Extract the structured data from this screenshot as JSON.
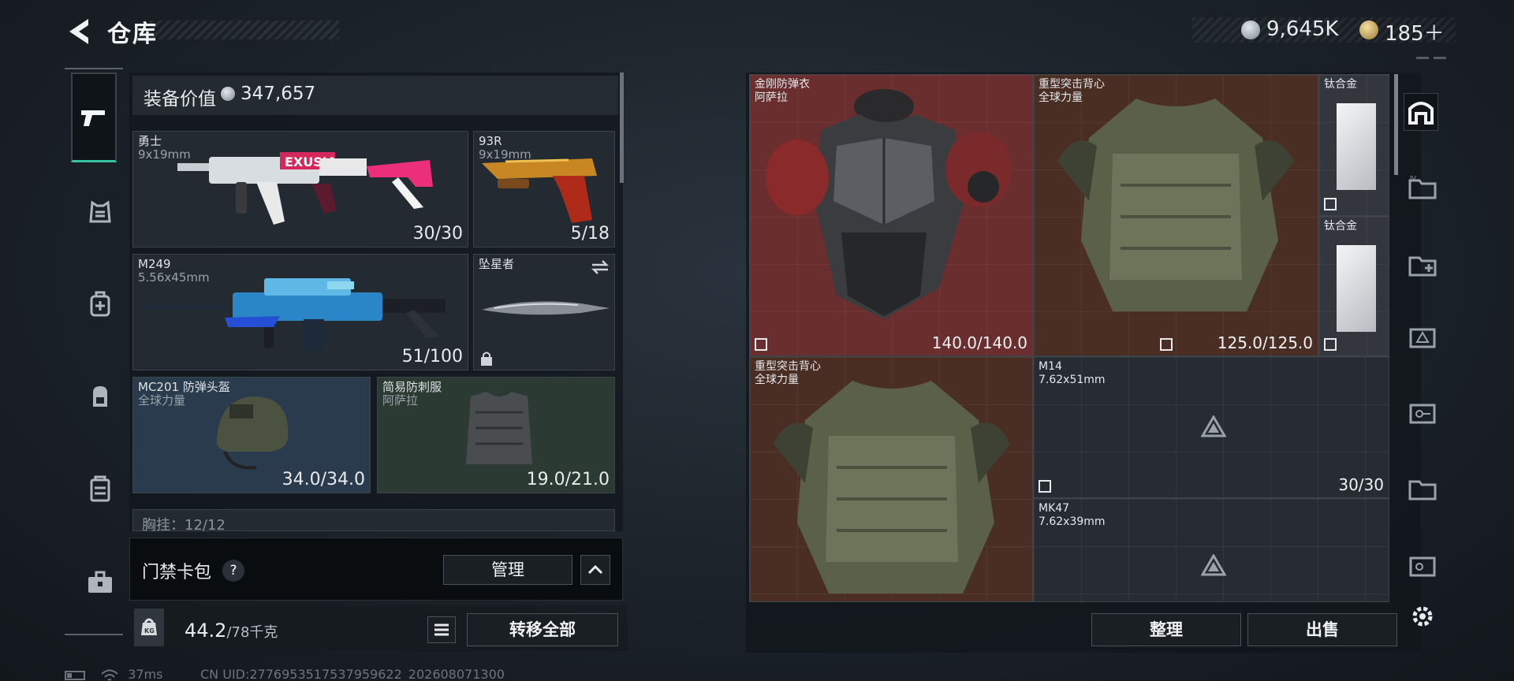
{
  "header": {
    "title": "仓库",
    "currency_silver": "9,645K",
    "currency_gold": "185＋"
  },
  "equipment": {
    "label": "装备价值",
    "value": "347,657"
  },
  "loadout": [
    {
      "name": "勇士",
      "ammo": "9x19mm",
      "count": "30/30"
    },
    {
      "name": "93R",
      "ammo": "9x19mm",
      "count": "5/18"
    },
    {
      "name": "M249",
      "ammo": "5.56x45mm",
      "count": "51/100"
    },
    {
      "name": "坠星者",
      "ammo": "",
      "count": ""
    },
    {
      "name": "MC201 防弹头盔",
      "brand": "全球力量",
      "count": "34.0/34.0"
    },
    {
      "name": "简易防刺服",
      "brand": "阿萨拉",
      "count": "19.0/21.0"
    }
  ],
  "chest_rig": {
    "text": "胸挂：12/12"
  },
  "card_pack": {
    "label": "门禁卡包",
    "help": "?",
    "manage": "管理"
  },
  "weight": {
    "current": "44.2",
    "capacity": "/78千克",
    "transfer_all": "转移全部"
  },
  "status": {
    "ping": "37ms",
    "uid": "CN UID:2776953517537959622_202608071300"
  },
  "storage": [
    {
      "name": "金刚防弹衣",
      "brand": "阿萨拉",
      "count": "140.0/140.0"
    },
    {
      "name": "重型突击背心",
      "brand": "全球力量",
      "count": "125.0/125.0"
    },
    {
      "name": "钛合金",
      "brand": "",
      "count": ""
    },
    {
      "name": "钛合金",
      "brand": "",
      "count": ""
    },
    {
      "name": "重型突击背心",
      "brand": "全球力量",
      "count": ""
    },
    {
      "name": "M14",
      "brand": "7.62x51mm",
      "count": "30/30"
    },
    {
      "name": "MK47",
      "brand": "7.62x39mm",
      "count": ""
    }
  ],
  "actions": {
    "tidy": "整理",
    "sell": "出售"
  },
  "colors": {
    "accent": "#39c1a4",
    "armor_red": "#6b2e2e",
    "armor_brown": "#4a2e24",
    "card_blue": "#2a3b4d",
    "card_green": "#2b3b33"
  },
  "icons": [
    "back-arrow-icon",
    "silver-coin-icon",
    "gold-coin-icon",
    "pistol-icon",
    "armor-icon",
    "medic-icon",
    "backpack-icon",
    "rig-icon",
    "toolbox-icon",
    "settings-icon",
    "lock-icon",
    "swap-icon",
    "triangle-icon",
    "no-insure-icon"
  ]
}
